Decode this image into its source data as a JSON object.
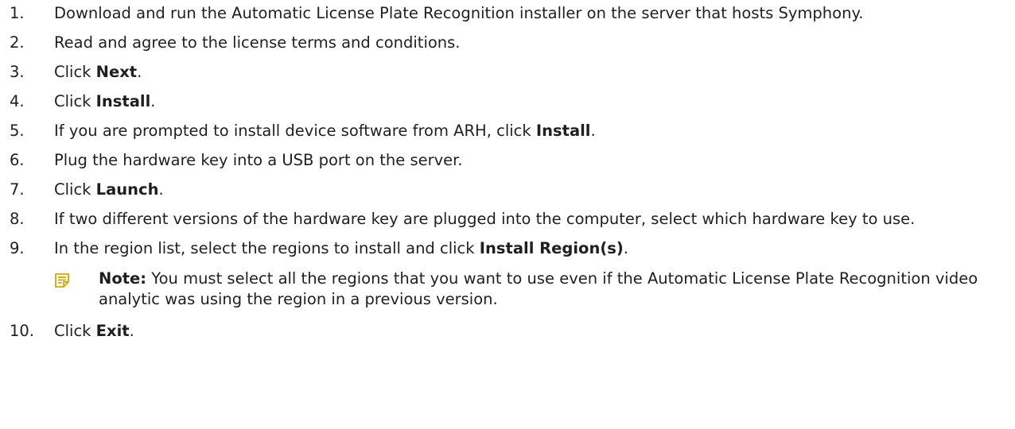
{
  "steps": [
    {
      "num": "1.",
      "text": "Download and run the Automatic License Plate Recognition installer on the server that hosts Symphony."
    },
    {
      "num": "2.",
      "text": "Read and agree to the license terms and conditions."
    },
    {
      "num": "3.",
      "pre": "Click ",
      "bold": "Next",
      "post": "."
    },
    {
      "num": "4.",
      "pre": "Click ",
      "bold": "Install",
      "post": "."
    },
    {
      "num": "5.",
      "pre": "If you are prompted to install device software from ARH, click ",
      "bold": "Install",
      "post": "."
    },
    {
      "num": "6.",
      "text": "Plug the hardware key into a USB port on the server."
    },
    {
      "num": "7.",
      "pre": "Click ",
      "bold": "Launch",
      "post": "."
    },
    {
      "num": "8.",
      "text": "If two different versions of the hardware key are plugged into the computer, select which hardware key to use."
    },
    {
      "num": "9.",
      "pre": "In the region list, select the regions to install and click ",
      "bold": "Install Region(s)",
      "post": "."
    },
    {
      "num": "10.",
      "pre": "Click ",
      "bold": "Exit",
      "post": "."
    }
  ],
  "note": {
    "label": "Note:",
    "text": "You must select all the regions that you want to use even if the Automatic License Plate Recognition video analytic was using the region in a previous version.",
    "icon": "note-icon"
  },
  "colors": {
    "text": "#1f1f1f",
    "note_icon": "#d9a400"
  }
}
